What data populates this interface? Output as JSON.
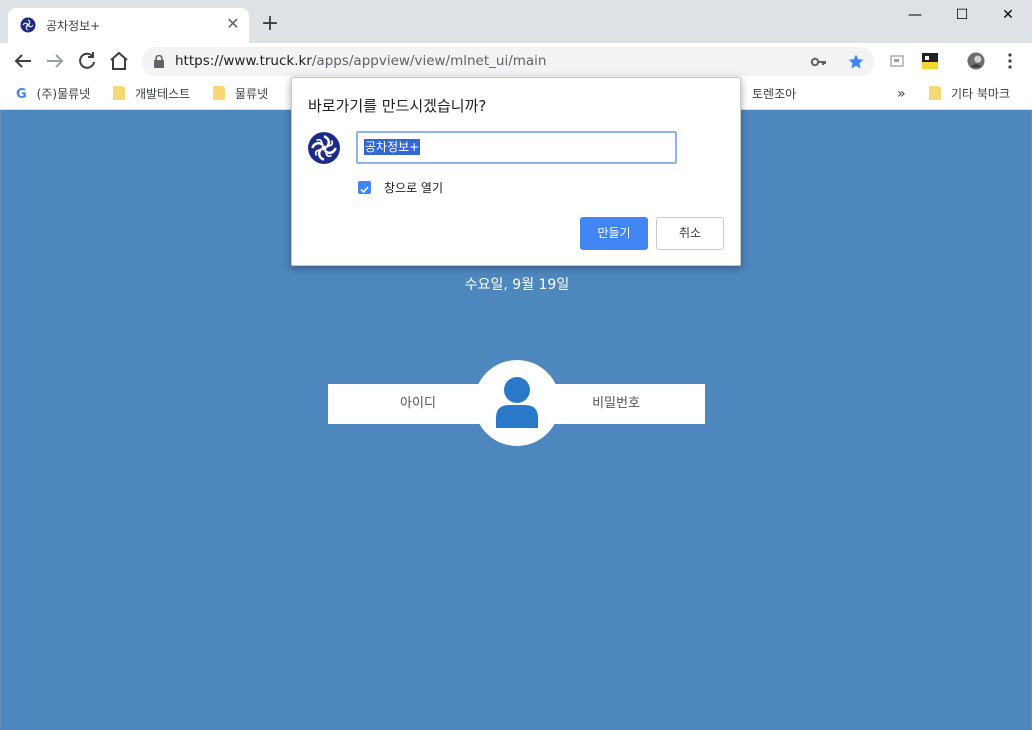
{
  "tab": {
    "title": "공차정보+",
    "close_label": "✕",
    "new_tab_label": "+"
  },
  "window_controls": {
    "minimize": "—",
    "maximize": "☐",
    "close": "✕"
  },
  "omnibox": {
    "url_main": "https://www.truck.kr",
    "url_path": "/apps/appview/view/mlnet_ui/main"
  },
  "bookmarks": {
    "items": [
      "(주)물류넷",
      "개발테스트",
      "물류넷",
      "토렌조아"
    ],
    "overflow": "»",
    "other": "기타 북마크"
  },
  "dialog": {
    "title": "바로가기를 만드시겠습니까?",
    "input_value": "공차정보+",
    "checkbox_label": "창으로 열기",
    "checkbox_checked": true,
    "create_button": "만들기",
    "cancel_button": "취소"
  },
  "page": {
    "date": "수요일, 9월 19일",
    "id_placeholder": "아이디",
    "password_placeholder": "비밀번호"
  },
  "colors": {
    "page_bg": "#4e86be",
    "accent": "#4285f4",
    "logo": "#1b2a8c"
  },
  "icons": {
    "favicon": "flower-logo-icon",
    "lock": "lock-icon",
    "key": "key-icon",
    "star": "star-icon",
    "user": "user-icon"
  }
}
